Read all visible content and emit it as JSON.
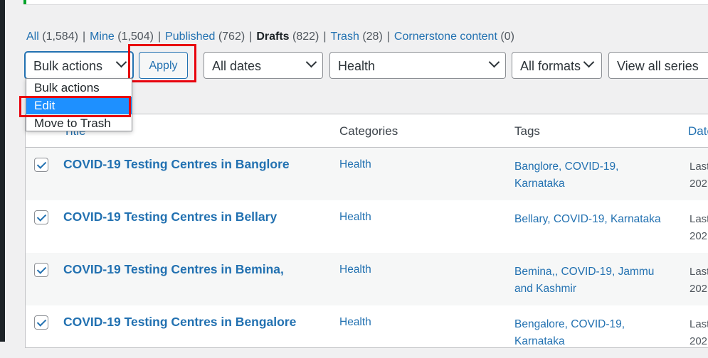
{
  "views": {
    "all_label": "All",
    "all_count": "(1,584)",
    "mine_label": "Mine",
    "mine_count": "(1,504)",
    "published_label": "Published",
    "published_count": "(762)",
    "drafts_label": "Drafts",
    "drafts_count": "(822)",
    "trash_label": "Trash",
    "trash_count": "(28)",
    "cornerstone_label": "Cornerstone content",
    "cornerstone_count": "(0)",
    "separator": "|"
  },
  "filters": {
    "bulk_actions": "Bulk actions",
    "apply": "Apply",
    "dates": "All dates",
    "category": "Health",
    "formats": "All formats",
    "series": "View all series"
  },
  "bulk_menu": {
    "options": [
      "Bulk actions",
      "Edit",
      "Move to Trash"
    ],
    "selected": "Edit"
  },
  "table": {
    "headers": {
      "title": "Title",
      "categories": "Categories",
      "tags": "Tags",
      "date": "Date"
    },
    "rows": [
      {
        "title": "COVID-19 Testing Centres in Banglore",
        "category": "Health",
        "tags": "Banglore, COVID-19, Karnataka",
        "date_line1": "Last",
        "date_line2": "202",
        "checked": true
      },
      {
        "title": "COVID-19 Testing Centres in Bellary",
        "category": "Health",
        "tags": "Bellary, COVID-19, Karnataka",
        "date_line1": "Last",
        "date_line2": "202",
        "checked": true
      },
      {
        "title": "COVID-19 Testing Centres in Bemina,",
        "category": "Health",
        "tags": "Bemina,, COVID-19, Jammu and Kashmir",
        "date_line1": "Last",
        "date_line2": "202",
        "checked": true
      },
      {
        "title": "COVID-19 Testing Centres in Bengalore",
        "category": "Health",
        "tags": "Bengalore, COVID-19, Karnataka",
        "date_line1": "Last",
        "date_line2": "202",
        "checked": true
      }
    ]
  },
  "colors": {
    "link": "#2271b1",
    "highlight": "#e8000d",
    "selected_option": "#1e90ff"
  }
}
